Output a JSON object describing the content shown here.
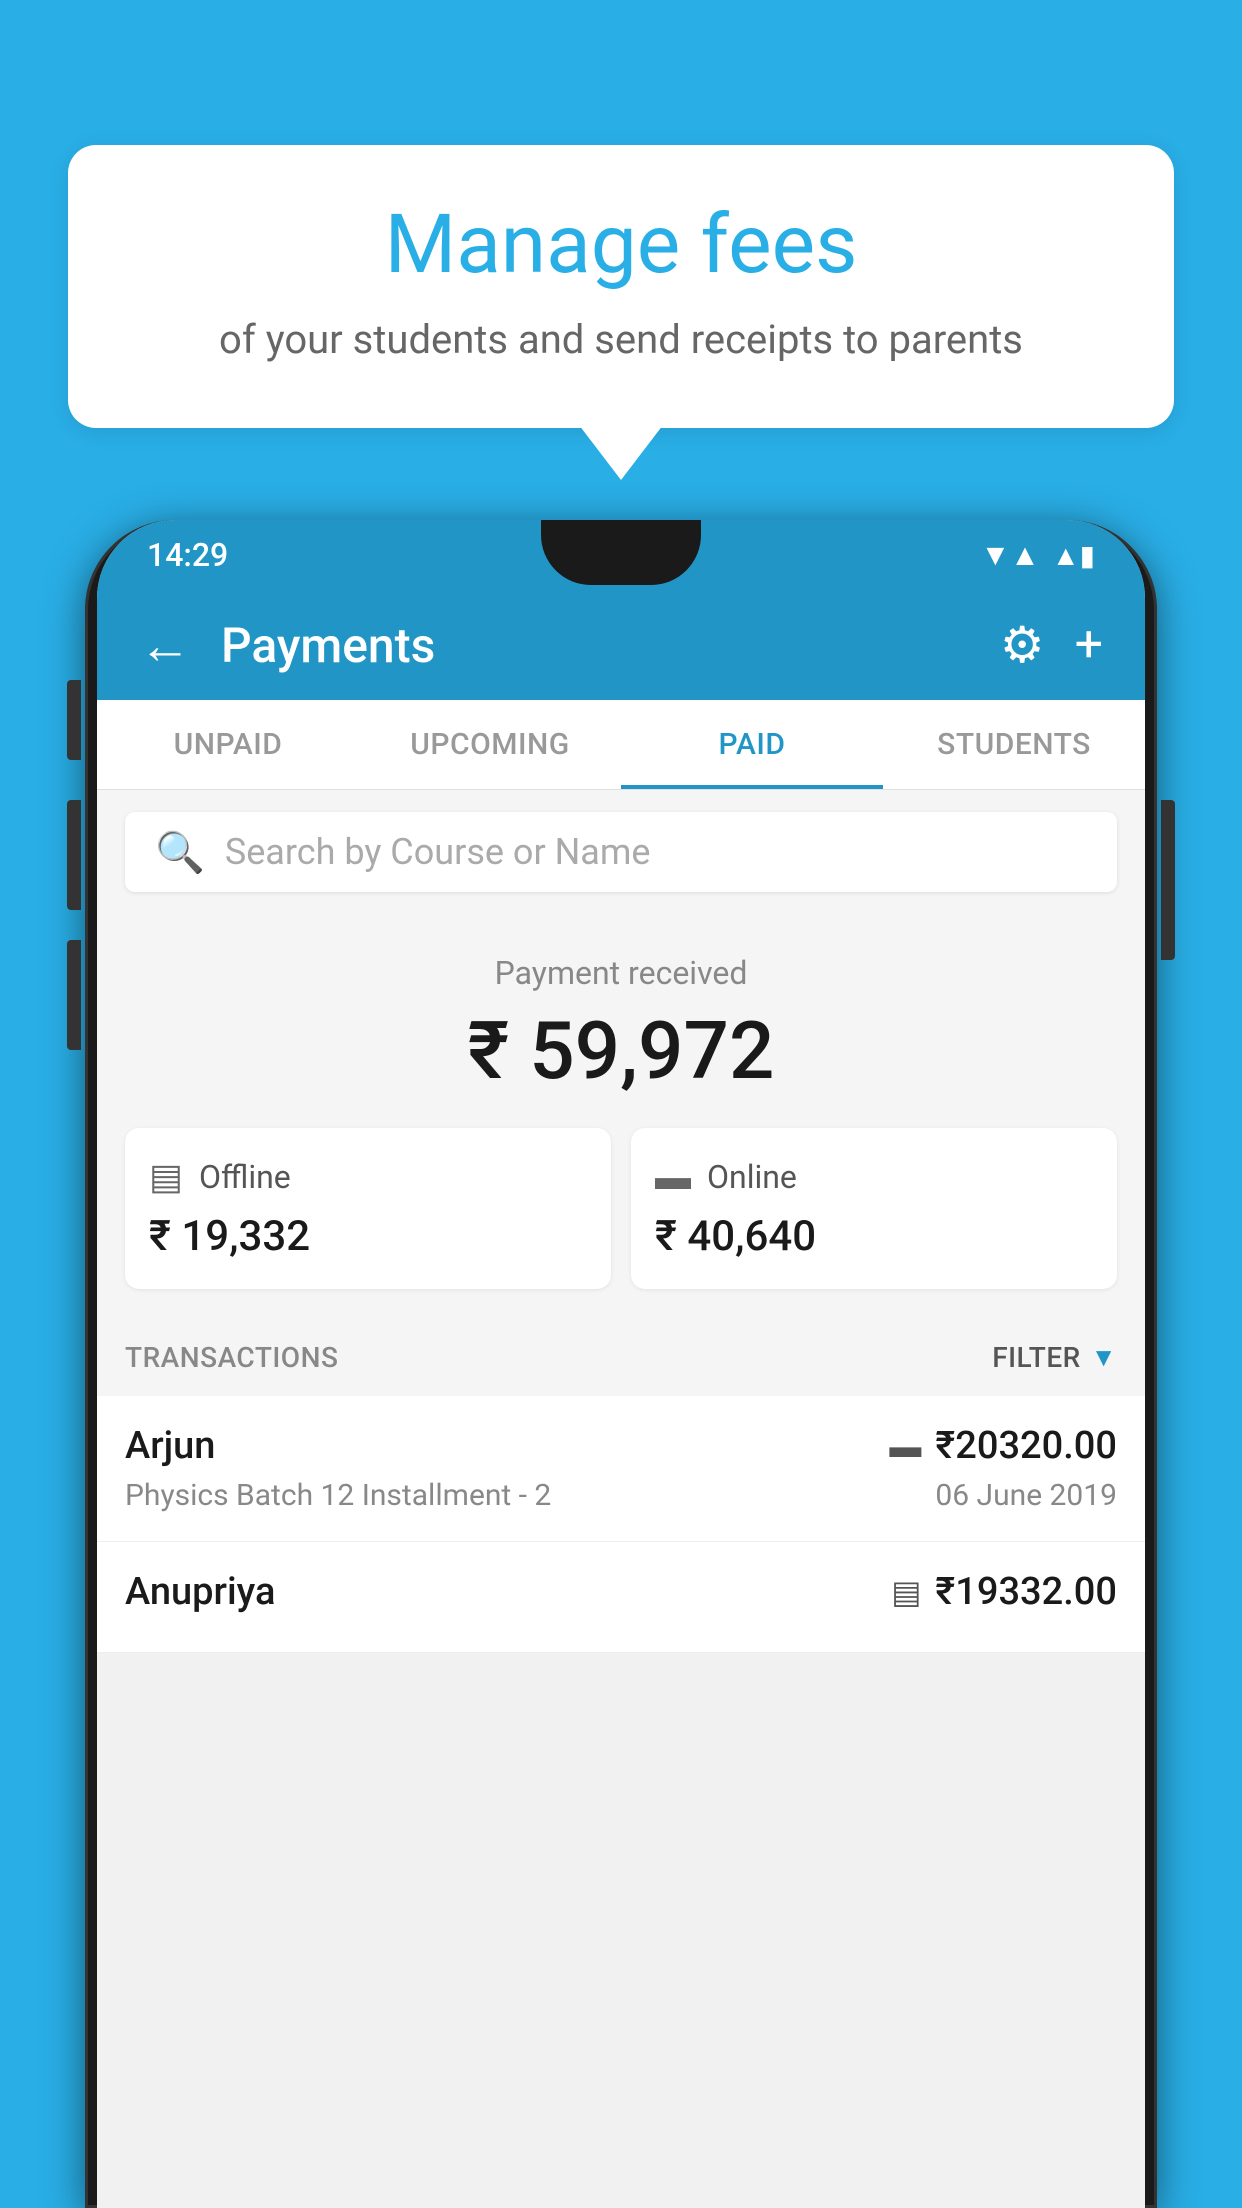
{
  "bubble": {
    "title": "Manage fees",
    "subtitle": "of your students and send receipts to parents"
  },
  "status_bar": {
    "time": "14:29",
    "wifi": "▼",
    "signal": "▲",
    "battery": "▮"
  },
  "header": {
    "title": "Payments",
    "back_label": "←",
    "gear_label": "⚙",
    "plus_label": "+"
  },
  "tabs": [
    {
      "label": "UNPAID",
      "active": false
    },
    {
      "label": "UPCOMING",
      "active": false
    },
    {
      "label": "PAID",
      "active": true
    },
    {
      "label": "STUDENTS",
      "active": false
    }
  ],
  "search": {
    "placeholder": "Search by Course or Name"
  },
  "payment_summary": {
    "label": "Payment received",
    "amount": "₹ 59,972",
    "offline": {
      "label": "Offline",
      "amount": "₹ 19,332"
    },
    "online": {
      "label": "Online",
      "amount": "₹ 40,640"
    }
  },
  "transactions_section": {
    "label": "TRANSACTIONS",
    "filter_label": "FILTER"
  },
  "transactions": [
    {
      "name": "Arjun",
      "course": "Physics Batch 12 Installment - 2",
      "amount": "₹20320.00",
      "date": "06 June 2019",
      "mode": "online"
    },
    {
      "name": "Anupriya",
      "course": "",
      "amount": "₹19332.00",
      "date": "",
      "mode": "offline"
    }
  ],
  "colors": {
    "brand_blue": "#29aee6",
    "app_header_blue": "#2196c6",
    "white": "#ffffff"
  }
}
